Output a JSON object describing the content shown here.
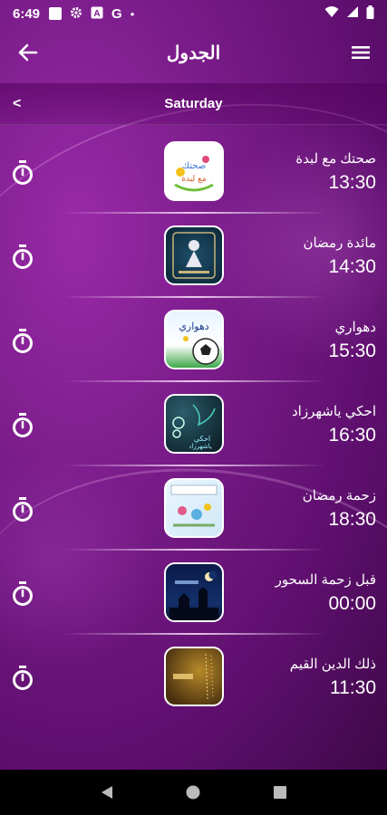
{
  "status_bar": {
    "time": "6:49",
    "icons": [
      "notification-square-icon",
      "gear-icon",
      "a-badge-icon",
      "google-icon",
      "dot-icon"
    ],
    "right_icons": [
      "wifi-icon",
      "signal-icon",
      "battery-icon"
    ],
    "g_label": "G",
    "a_label": "A",
    "dot": "•"
  },
  "app_bar": {
    "title": "الجدول",
    "back_icon": "arrow-left-icon",
    "menu_icon": "hamburger-menu-icon"
  },
  "day_bar": {
    "day": "Saturday",
    "prev_label": "<"
  },
  "schedule": [
    {
      "name": "صحتك مع لبدة",
      "time": "13:30",
      "thumb_text": "صحتك مع لبدة"
    },
    {
      "name": "مائدة رمضان",
      "time": "14:30",
      "thumb_text": ""
    },
    {
      "name": "دهواري",
      "time": "15:30",
      "thumb_text": "دهواري"
    },
    {
      "name": "احكي ياشهرزاد",
      "time": "16:30",
      "thumb_text": "احكي ياشهرزاد"
    },
    {
      "name": "زحمة رمضان",
      "time": "18:30",
      "thumb_text": ""
    },
    {
      "name": "قبل زحمة السحور",
      "time": "00:00",
      "thumb_text": ""
    },
    {
      "name": "ذلك الدين القيم",
      "time": "11:30",
      "thumb_text": ""
    }
  ],
  "colors": {
    "background_primary": "#7a1c8a",
    "background_dark": "#3e0848",
    "text": "#ffffff",
    "nav_bar": "#000000"
  },
  "nav_bar": {
    "icons": [
      "back-triangle-icon",
      "home-circle-icon",
      "recents-square-icon"
    ]
  }
}
